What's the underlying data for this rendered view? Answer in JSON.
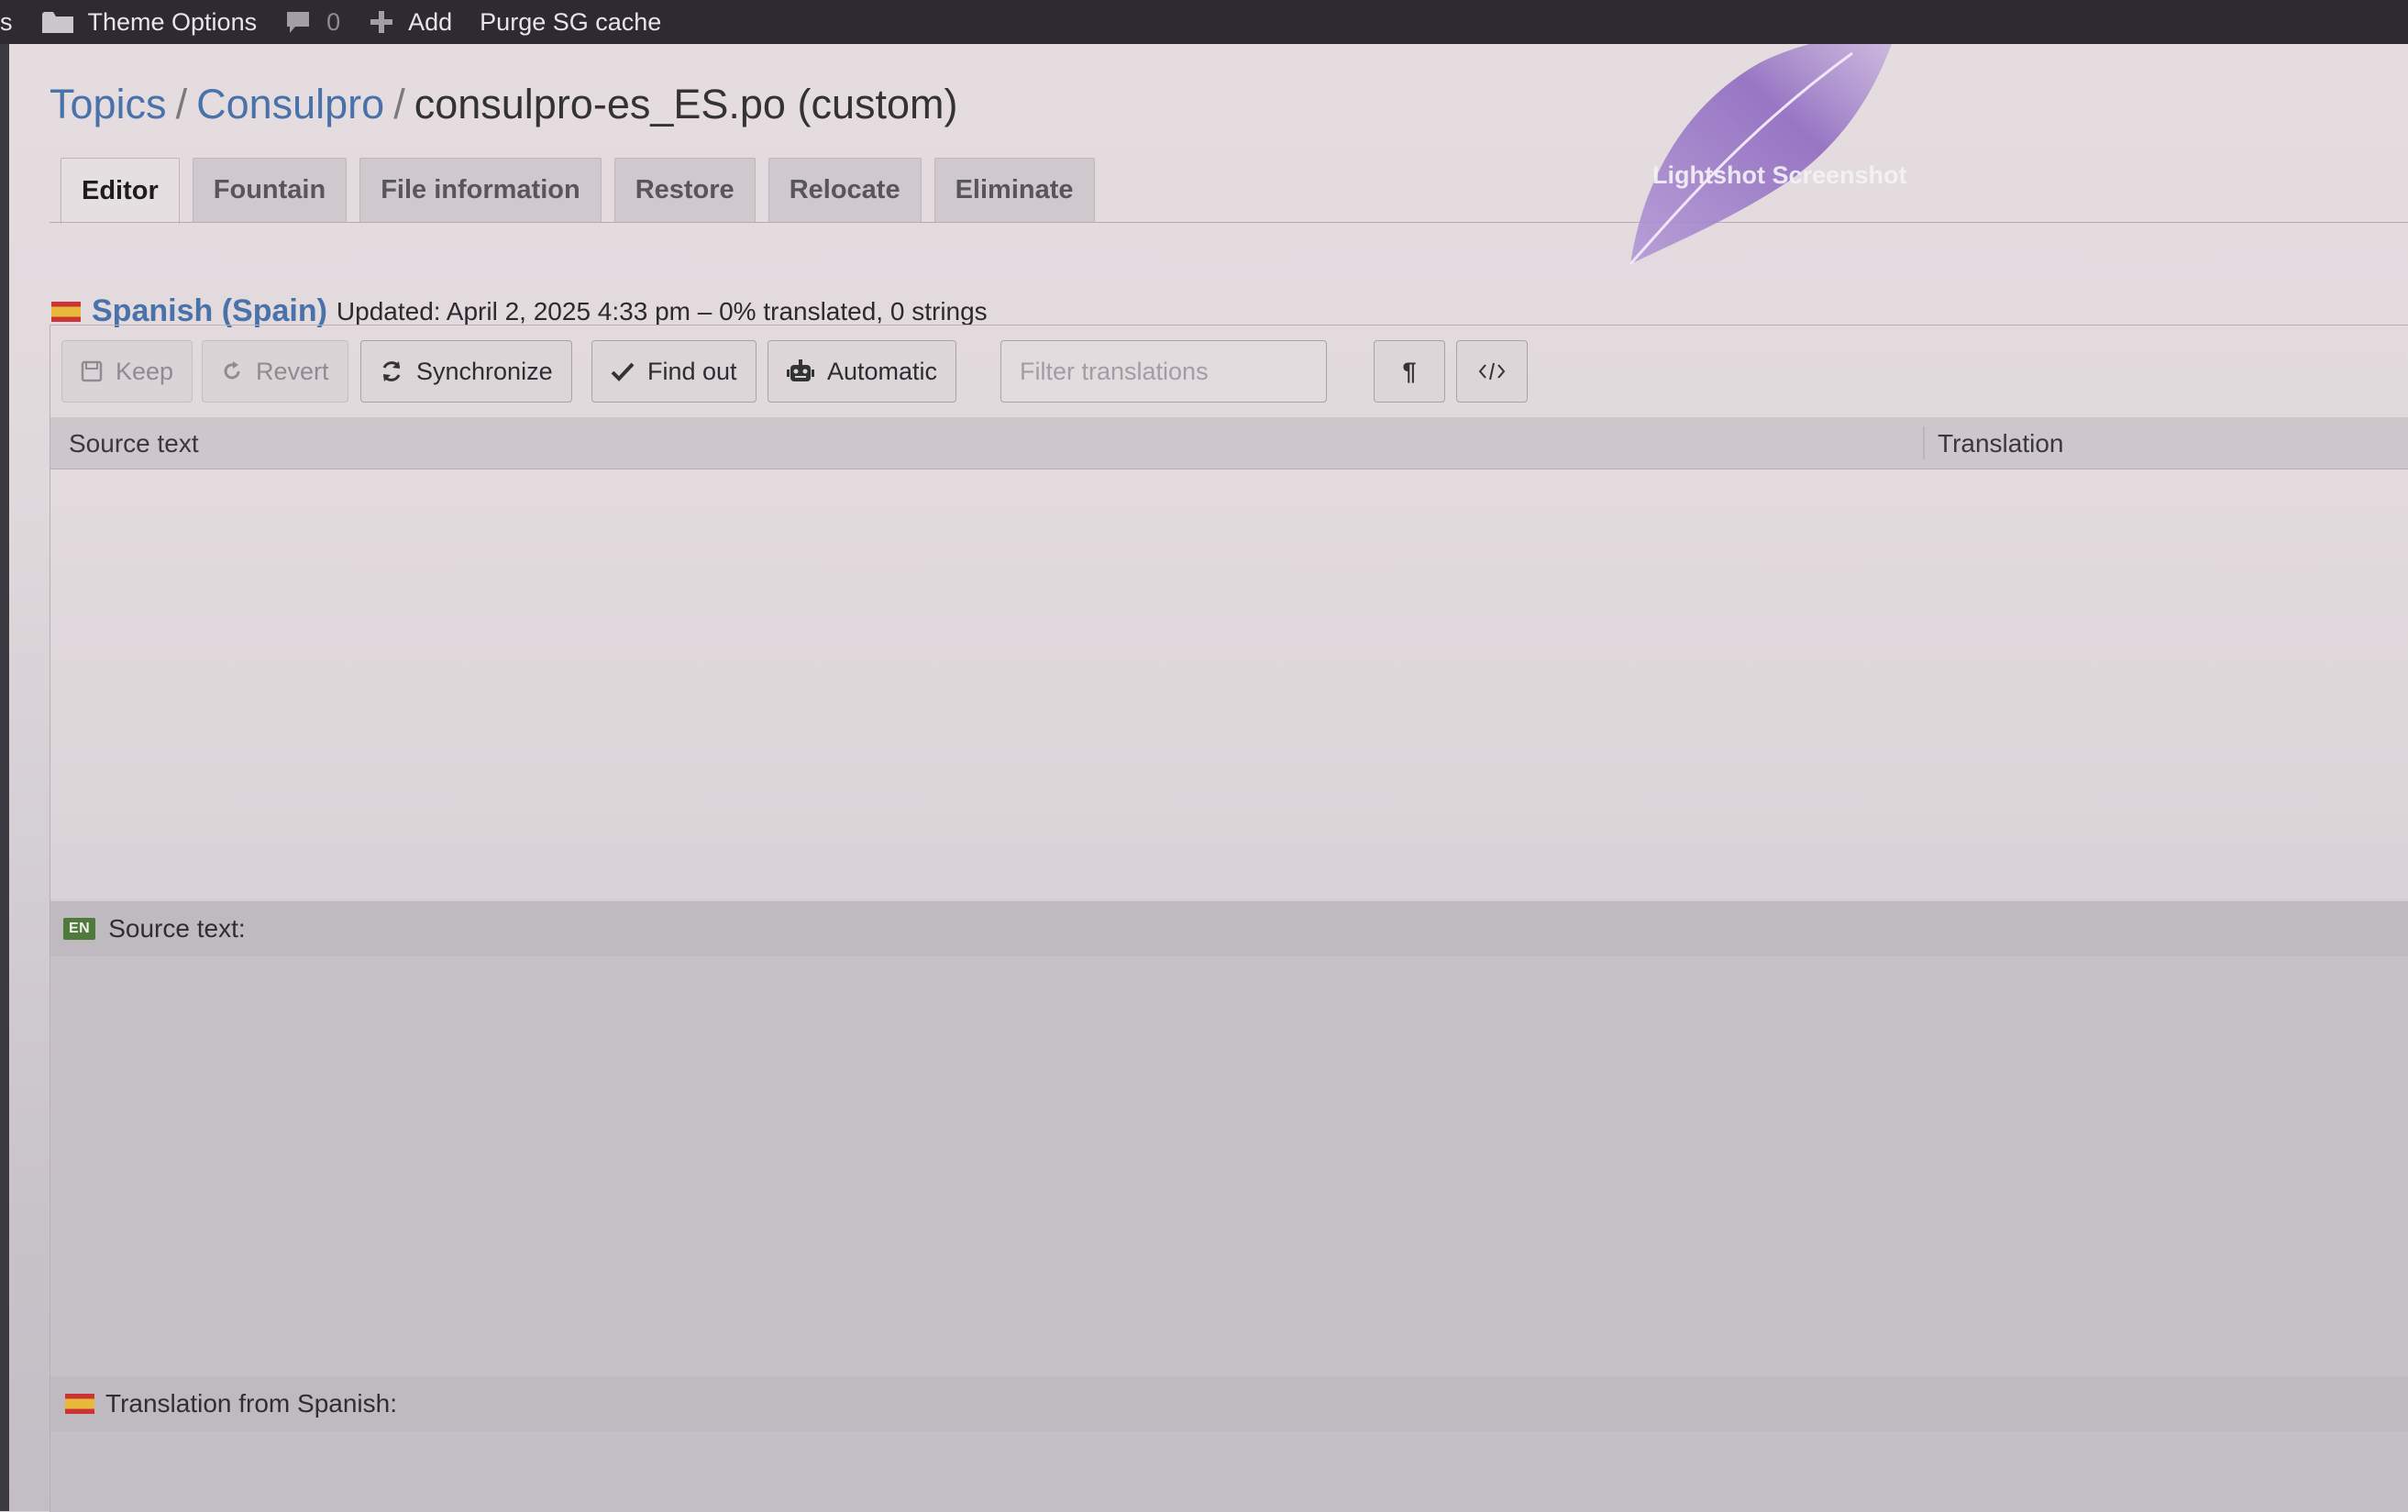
{
  "adminbar": {
    "partial_left": "s",
    "theme_options": "Theme Options",
    "comments_count": "0",
    "add_label": "Add",
    "purge_label": "Purge SG cache"
  },
  "breadcrumb": {
    "items": [
      "Topics",
      "Consulpro"
    ],
    "separator": "/",
    "current": "consulpro-es_ES.po (custom)"
  },
  "tabs": [
    {
      "label": "Editor",
      "active": true
    },
    {
      "label": "Fountain"
    },
    {
      "label": "File information"
    },
    {
      "label": "Restore"
    },
    {
      "label": "Relocate"
    },
    {
      "label": "Eliminate"
    }
  ],
  "language": {
    "name": "Spanish (Spain)",
    "status": "Updated: April 2, 2025 4:33 pm – 0% translated, 0 strings"
  },
  "toolbar": {
    "keep": "Keep",
    "revert": "Revert",
    "synchronize": "Synchronize",
    "find_out": "Find out",
    "automatic": "Automatic",
    "filter_placeholder": "Filter translations"
  },
  "columns": {
    "source": "Source text",
    "translation": "Translation"
  },
  "source_panel": {
    "badge": "EN",
    "label": "Source text:"
  },
  "translation_panel": {
    "label": "Translation from Spanish:"
  },
  "watermark": {
    "text": "Lightshot Screenshot"
  },
  "colors": {
    "link": "#4a72aa",
    "adminbar": "#2d2b31",
    "en_badge": "#4e7a3b"
  }
}
